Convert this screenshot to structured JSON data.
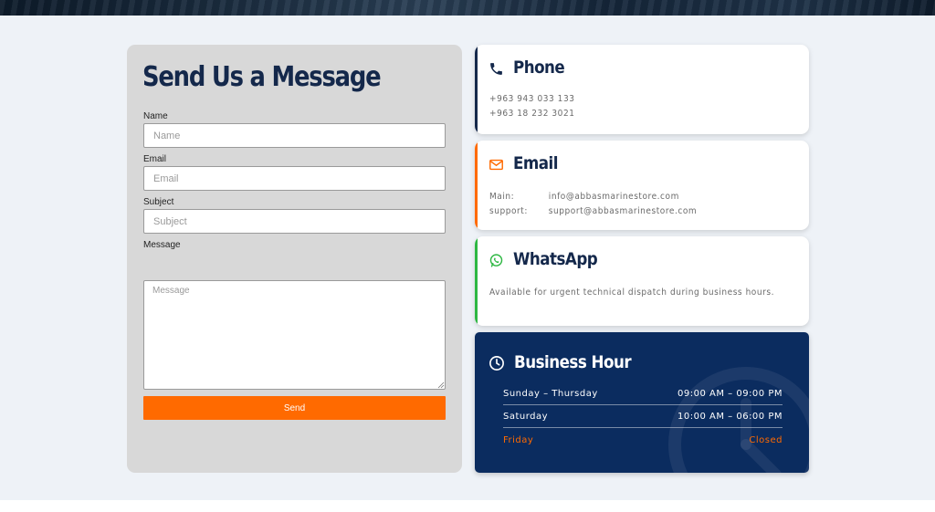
{
  "form": {
    "title": "Send Us a Message",
    "fields": {
      "name": {
        "label": "Name",
        "placeholder": "Name"
      },
      "email": {
        "label": "Email",
        "placeholder": "Email"
      },
      "subject": {
        "label": "Subject",
        "placeholder": "Subject"
      },
      "message": {
        "label": "Message",
        "placeholder": "Message"
      }
    },
    "send_label": "Send"
  },
  "phone": {
    "title": "Phone",
    "icon": "phone-icon",
    "numbers": [
      "+963 943 033 133",
      "+963 18 232 3021"
    ],
    "accent": "#14284b"
  },
  "email": {
    "title": "Email",
    "icon": "envelope-icon",
    "entries": [
      {
        "key": "Main:",
        "value": "info@abbasmarinestore.com"
      },
      {
        "key": "support:",
        "value": "support@abbasmarinestore.com"
      }
    ],
    "accent": "#ff6a00"
  },
  "whatsapp": {
    "title": "WhatsApp",
    "icon": "whatsapp-icon",
    "text": "Available for urgent technical dispatch during business hours.",
    "accent": "#2db742"
  },
  "hours": {
    "title": "Business Hour",
    "icon": "clock-icon",
    "rows": [
      {
        "day": "Sunday – Thursday",
        "time": "09:00 AM – 09:00 PM"
      },
      {
        "day": "Saturday",
        "time": "10:00 AM – 06:00 PM"
      },
      {
        "day": "Friday",
        "time": "Closed"
      }
    ]
  },
  "colors": {
    "navy": "#0b2c5f",
    "orange": "#ff6a00",
    "green": "#2db742",
    "section_bg": "#eef2f7"
  }
}
